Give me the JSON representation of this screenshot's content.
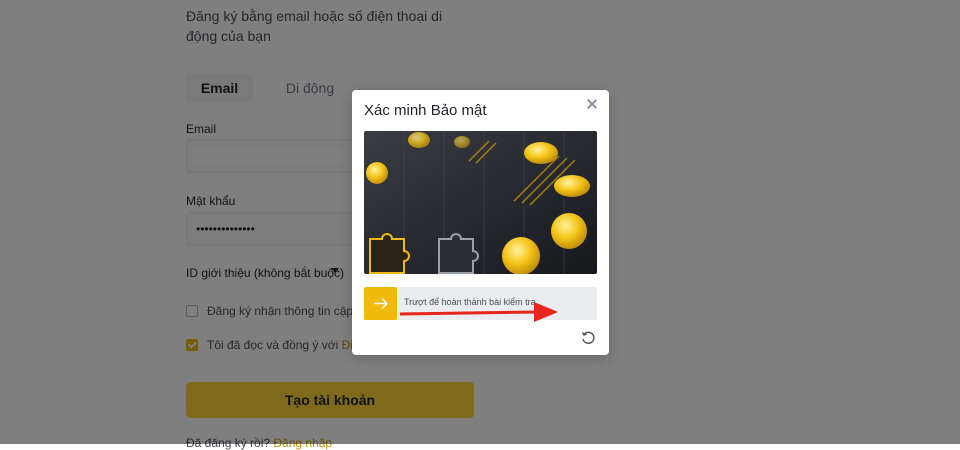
{
  "signup": {
    "subtitle": "Đăng ký bằng email hoặc số điện thoại di động của bạn",
    "tabs": [
      "Email",
      "Di động"
    ],
    "email_label": "Email",
    "password_label": "Mật khẩu",
    "password_value": "••••••••••••••",
    "referral_label": "ID giới thiệu (không bắt buộc)",
    "newsletter_text": "Đăng ký nhận thông tin cập nhậ",
    "terms_text": "Tôi đã đọc và đồng ý với ",
    "terms_link": "Điều k",
    "create_button": "Tạo tài khoản",
    "login_prompt": "Đã đăng ký rồi? ",
    "login_link": "Đăng nhập"
  },
  "captcha": {
    "title": "Xác minh Bảo mật",
    "slider_text": "Trượt để hoàn thành bài kiểm tra"
  },
  "colors": {
    "accent": "#f0b90b",
    "button": "#fcd535",
    "arrow": "#e8251c"
  },
  "icons": [
    "close-icon",
    "arrow-right-icon",
    "refresh-icon",
    "chevron-down-icon",
    "check-icon"
  ]
}
